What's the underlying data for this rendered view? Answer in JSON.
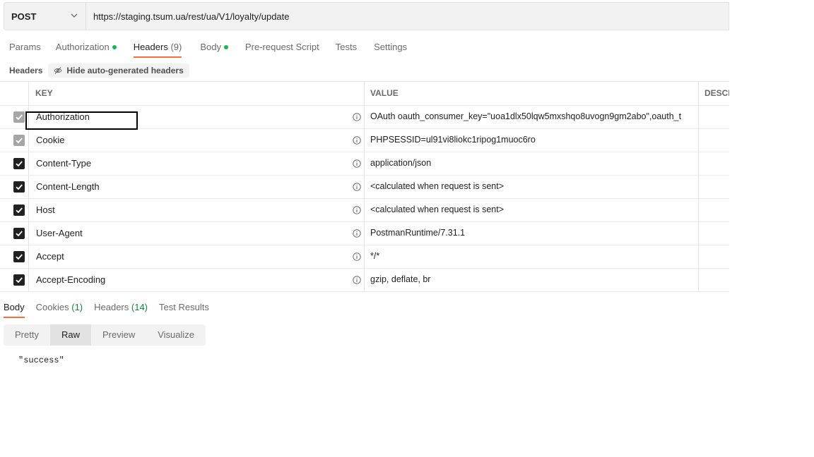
{
  "request": {
    "method": "POST",
    "url": "https://staging.tsum.ua/rest/ua/V1/loyalty/update"
  },
  "req_tabs": [
    {
      "label": "Params",
      "count": "",
      "dot": false,
      "active": false
    },
    {
      "label": "Authorization",
      "count": "",
      "dot": true,
      "active": false
    },
    {
      "label": "Headers",
      "count": "(9)",
      "dot": false,
      "active": true
    },
    {
      "label": "Body",
      "count": "",
      "dot": true,
      "active": false
    },
    {
      "label": "Pre-request Script",
      "count": "",
      "dot": false,
      "active": false
    },
    {
      "label": "Tests",
      "count": "",
      "dot": false,
      "active": false
    },
    {
      "label": "Settings",
      "count": "",
      "dot": false,
      "active": false
    }
  ],
  "headers_section": {
    "title": "Headers",
    "hide_button": "Hide auto-generated headers"
  },
  "table": {
    "columns": {
      "key": "KEY",
      "value": "VALUE",
      "description": "DESCR"
    },
    "rows": [
      {
        "key": "Authorization",
        "value": "OAuth oauth_consumer_key=\"uoa1dlx50lqw5mxshqo8uvogn9gm2abo\",oauth_t",
        "checked": true,
        "disabled": true
      },
      {
        "key": "Cookie",
        "value": "PHPSESSID=ul91vi8liokc1ripog1muoc6ro",
        "checked": true,
        "disabled": true
      },
      {
        "key": "Content-Type",
        "value": "application/json",
        "checked": true,
        "disabled": false
      },
      {
        "key": "Content-Length",
        "value": "<calculated when request is sent>",
        "checked": true,
        "disabled": false
      },
      {
        "key": "Host",
        "value": "<calculated when request is sent>",
        "checked": true,
        "disabled": false
      },
      {
        "key": "User-Agent",
        "value": "PostmanRuntime/7.31.1",
        "checked": true,
        "disabled": false
      },
      {
        "key": "Accept",
        "value": "*/*",
        "checked": true,
        "disabled": false
      },
      {
        "key": "Accept-Encoding",
        "value": "gzip, deflate, br",
        "checked": true,
        "disabled": false
      }
    ]
  },
  "response": {
    "tabs": [
      {
        "label": "Body",
        "count": "",
        "active": true
      },
      {
        "label": "Cookies",
        "count": "(1)",
        "active": false
      },
      {
        "label": "Headers",
        "count": "(14)",
        "active": false
      },
      {
        "label": "Test Results",
        "count": "",
        "active": false
      }
    ],
    "view_options": [
      {
        "label": "Pretty",
        "active": false
      },
      {
        "label": "Raw",
        "active": true
      },
      {
        "label": "Preview",
        "active": false
      },
      {
        "label": "Visualize",
        "active": false
      }
    ],
    "body": "\"success\""
  },
  "colors": {
    "accent": "#ff6c37",
    "status_dot": "#0cbb52"
  },
  "icons": {
    "method_dropdown": "chevron-down-icon",
    "hide": "eye-off-icon",
    "info": "info-icon",
    "check": "check-icon"
  }
}
